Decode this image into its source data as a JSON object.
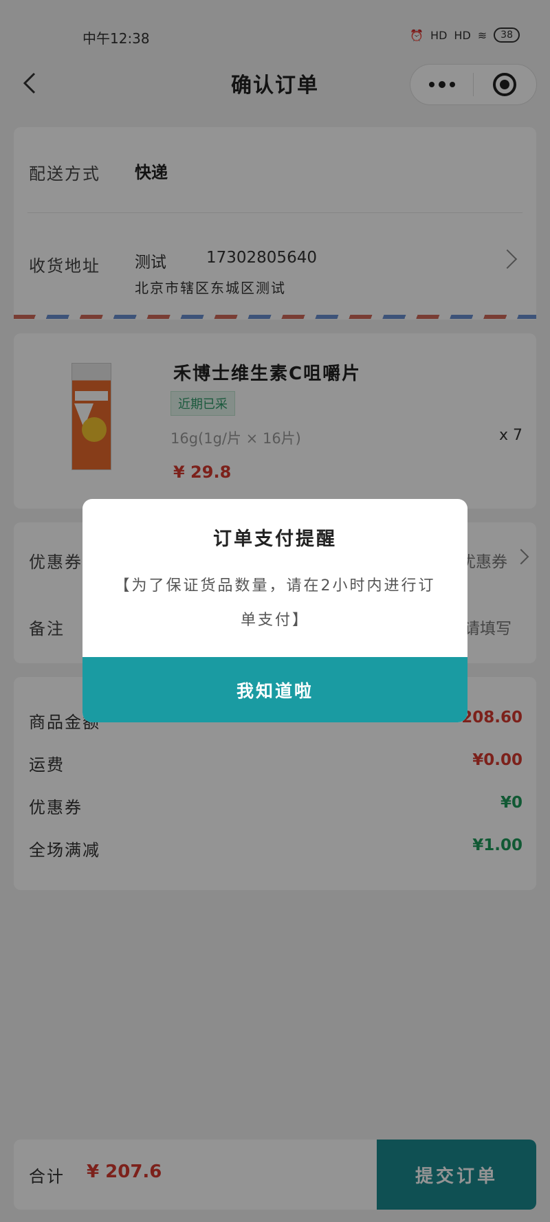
{
  "status_bar": {
    "time": "中午12:38",
    "signal1": "HD",
    "signal2": "HD",
    "battery": "38"
  },
  "nav": {
    "title": "确认订单"
  },
  "delivery": {
    "label": "配送方式",
    "value": "快递"
  },
  "address": {
    "label": "收货地址",
    "name": "测试",
    "phone": "17302805640",
    "detail": "北京市辖区东城区测试"
  },
  "product": {
    "name": "禾博士维生素C咀嚼片",
    "tag": "近期已采",
    "spec": "16g(1g/片 × 16片)",
    "qty": "x 7",
    "price": "¥ 29.8"
  },
  "options": {
    "coupon_label": "优惠券",
    "coupon_value": "优惠券",
    "remark_label": "备注",
    "remark_placeholder": "请填写"
  },
  "summary": {
    "goods_label": "商品金额",
    "goods_value": "¥208.60",
    "shipping_label": "运费",
    "shipping_value": "¥0.00",
    "coupon_label": "优惠券",
    "coupon_value": "¥0",
    "discount_label": "全场满减",
    "discount_value": "¥1.00"
  },
  "bottom": {
    "total_label": "合计",
    "total_value": "¥ 207.6",
    "submit_label": "提交订单"
  },
  "dialog": {
    "title": "订单支付提醒",
    "message": "【为了保证货品数量，请在2小时内进行订单支付】",
    "button": "我知道啦"
  },
  "colors": {
    "accent": "#1a9ba2",
    "price_red": "#d63a2f",
    "green": "#1e9a5a"
  }
}
